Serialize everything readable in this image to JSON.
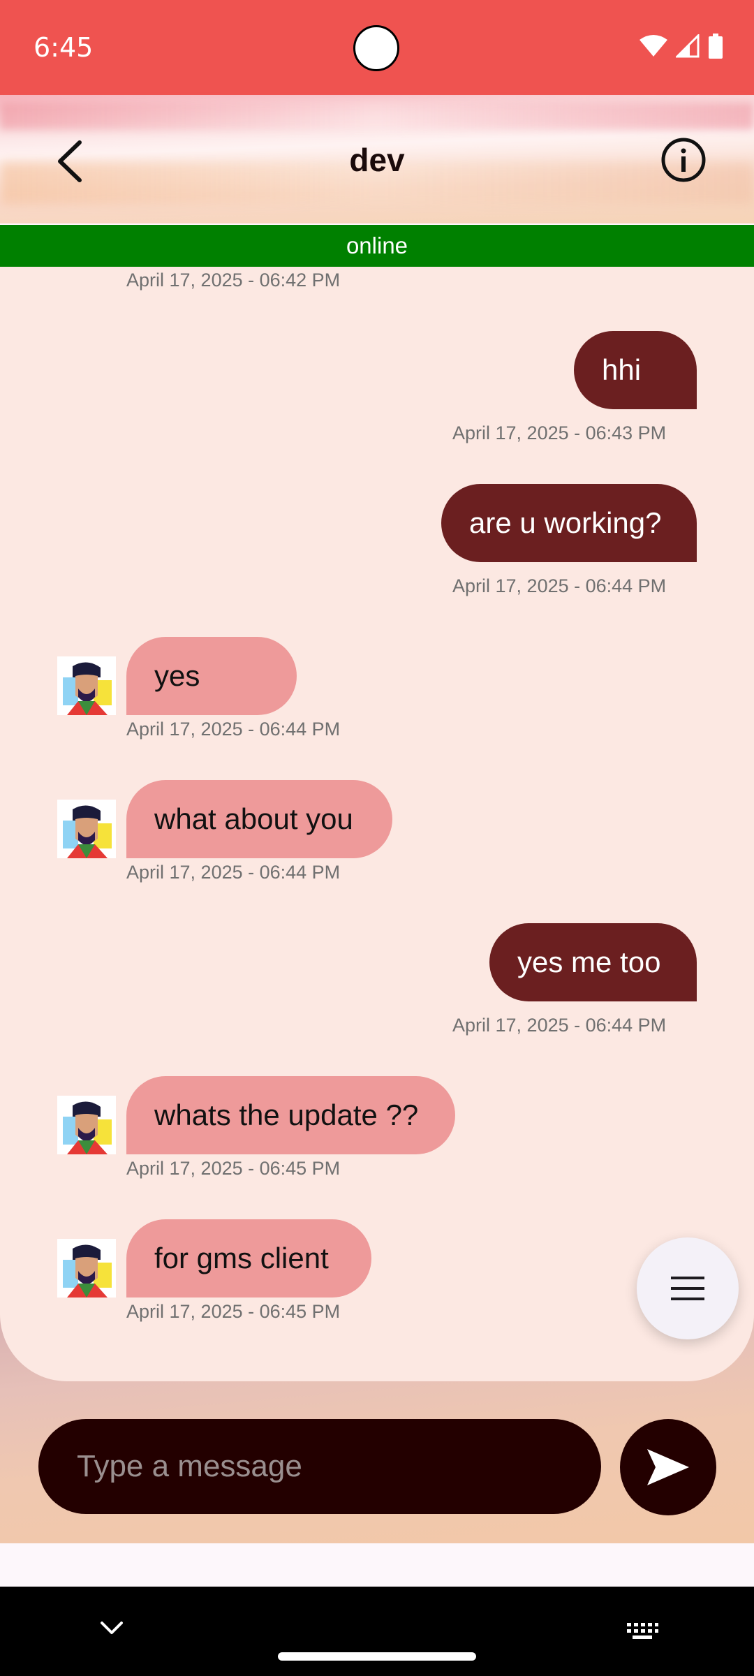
{
  "status_bar": {
    "time": "6:45"
  },
  "header": {
    "title": "dev",
    "status": "online"
  },
  "messages": [
    {
      "type": "recv",
      "timestamp": "April 17, 2025 - 06:42 PM"
    },
    {
      "type": "sent",
      "text": "hhi",
      "timestamp": "April 17, 2025 - 06:43 PM"
    },
    {
      "type": "sent",
      "text": "are u working?",
      "timestamp": "April 17, 2025 - 06:44 PM"
    },
    {
      "type": "recv",
      "text": "yes",
      "timestamp": "April 17, 2025 - 06:44 PM"
    },
    {
      "type": "recv",
      "text": "what about you",
      "timestamp": "April 17, 2025 - 06:44 PM"
    },
    {
      "type": "sent",
      "text": "yes me too",
      "timestamp": "April 17, 2025 - 06:44 PM"
    },
    {
      "type": "recv",
      "text": "whats the update ??",
      "timestamp": "April 17, 2025 - 06:45 PM"
    },
    {
      "type": "recv",
      "text": "for gms client",
      "timestamp": "April 17, 2025 - 06:45 PM"
    }
  ],
  "composer": {
    "placeholder": "Type a message"
  },
  "icons": {
    "back": "arrow-back-icon",
    "info": "info-icon",
    "menu": "menu-icon",
    "send": "send-icon"
  },
  "colors": {
    "status_bar": "#ef5350",
    "online_bar": "#008000",
    "sent_bubble": "#6b1f20",
    "received_bubble": "#ee9a9a",
    "composer": "#230000",
    "chat_background": "#fce8e2"
  }
}
